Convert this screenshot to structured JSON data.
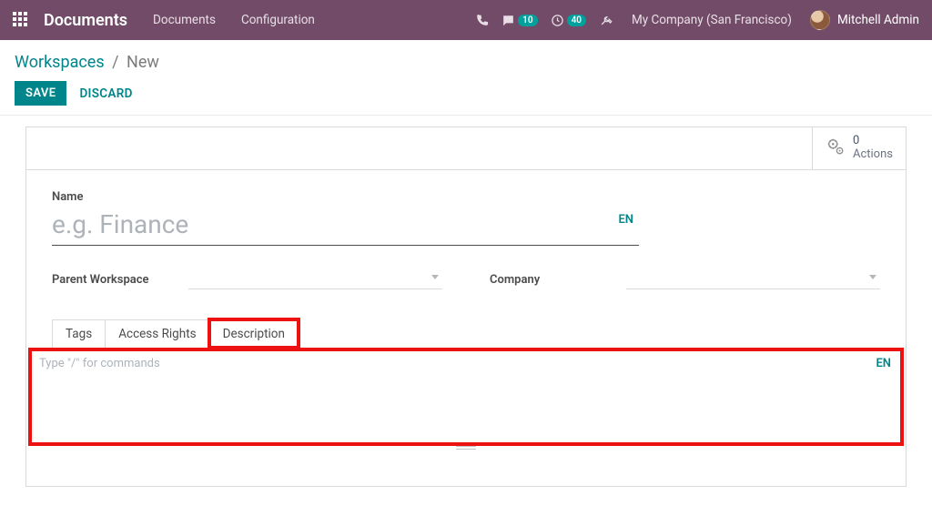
{
  "navbar": {
    "app_title": "Documents",
    "links": [
      "Documents",
      "Configuration"
    ],
    "chat_badge": "10",
    "activity_badge": "40",
    "company": "My Company (San Francisco)",
    "user": "Mitchell Admin"
  },
  "breadcrumb": {
    "root": "Workspaces",
    "sep": "/",
    "current": "New"
  },
  "buttons": {
    "save": "SAVE",
    "discard": "DISCARD"
  },
  "actions_button": {
    "count": "0",
    "label": "Actions"
  },
  "fields": {
    "name_label": "Name",
    "name_placeholder": "e.g. Finance",
    "name_lang": "EN",
    "parent_label": "Parent Workspace",
    "company_label": "Company"
  },
  "tabs": {
    "tags": "Tags",
    "access": "Access Rights",
    "description": "Description"
  },
  "editor": {
    "placeholder": "Type \"/\" for commands",
    "lang": "EN"
  }
}
